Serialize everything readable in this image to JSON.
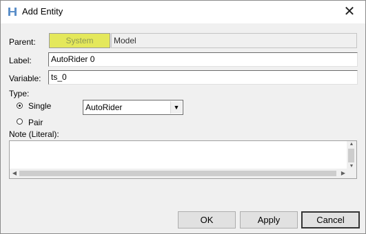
{
  "window": {
    "title": "Add Entity",
    "close_symbol": "✕"
  },
  "form": {
    "parent_label": "Parent:",
    "parent_system": "System",
    "parent_model": "Model",
    "label_label": "Label:",
    "label_value": "AutoRider 0",
    "variable_label": "Variable:",
    "variable_value": "ts_0",
    "type_label": "Type:",
    "type_single": "Single",
    "type_pair": "Pair",
    "type_selected": "Single",
    "entity_select_value": "AutoRider",
    "note_label": "Note (Literal):",
    "note_value": ""
  },
  "buttons": {
    "ok": "OK",
    "apply": "Apply",
    "cancel": "Cancel"
  },
  "colors": {
    "parent_system_bg": "#e4e85b"
  }
}
